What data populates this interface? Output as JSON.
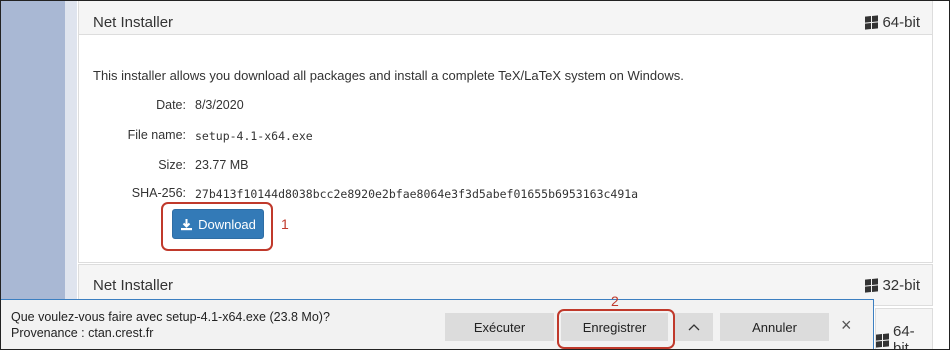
{
  "installers": [
    {
      "title": "Net Installer",
      "arch": "64-bit",
      "description": "This installer allows you download all packages and install a complete TeX/LaTeX system on Windows.",
      "details": [
        {
          "label": "Date:",
          "value": "8/3/2020"
        },
        {
          "label": "File name:",
          "value": "setup-4.1-x64.exe"
        },
        {
          "label": "Size:",
          "value": "23.77 MB"
        },
        {
          "label": "SHA-256:",
          "value": "27b413f10144d8038bcc2e8920e2bfae8064e3f3d5abef01655b6953163c491a"
        }
      ],
      "download_label": "Download"
    },
    {
      "title": "Net Installer",
      "arch": "32-bit"
    }
  ],
  "third_arch": "64-bit",
  "annotations": {
    "step1": "1",
    "step2": "2"
  },
  "download_bar": {
    "question": "Que voulez-vous faire avec setup-4.1-x64.exe (23.8 Mo)?",
    "source": "Provenance : ctan.crest.fr",
    "run_label": "Exécuter",
    "save_label": "Enregistrer",
    "cancel_label": "Annuler",
    "close_symbol": "×"
  },
  "colors": {
    "accent": "#337ab7",
    "annotation": "#c0392b",
    "bar_border": "#3c7fc1"
  },
  "icons": {
    "os": "windows-icon",
    "download": "download-icon",
    "expand": "chevron-up-icon",
    "close": "close-icon"
  }
}
